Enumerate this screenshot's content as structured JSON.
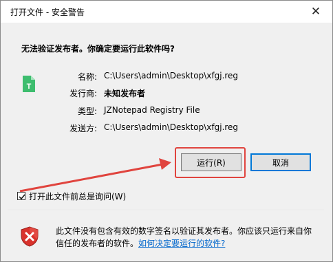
{
  "window": {
    "title": "打开文件 - 安全警告",
    "close_glyph": "✕"
  },
  "question": "无法验证发布者。你确定要运行此软件吗?",
  "file_icon_letter": "T",
  "info": [
    {
      "label": "名称:",
      "value": "C:\\Users\\admin\\Desktop\\xfgj.reg"
    },
    {
      "label": "发行商:",
      "value": "未知发布者"
    },
    {
      "label": "类型:",
      "value": "JZNotepad Registry File"
    },
    {
      "label": "发送方:",
      "value": "C:\\Users\\admin\\Desktop\\xfgj.reg"
    }
  ],
  "buttons": {
    "run": "运行(R)",
    "cancel": "取消"
  },
  "checkbox": {
    "label": "打开此文件前总是询问(W)",
    "checked": true
  },
  "warning": {
    "text": "此文件没有包含有效的数字签名以验证其发布者。你应该只运行来自你信任的发布者的软件。",
    "link": "如何决定要运行的软件?"
  },
  "colors": {
    "highlight": "#e0443e",
    "link": "#0066cc",
    "file_icon": "#3dbd6e",
    "shield": "#d9322c"
  }
}
